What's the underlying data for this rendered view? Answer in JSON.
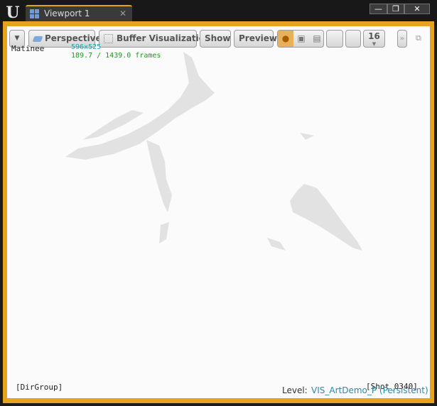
{
  "app": {
    "logo": "U"
  },
  "tab": {
    "title": "Viewport 1",
    "close": "✕",
    "icon": "viewport-grid-icon"
  },
  "window": {
    "minimize": "—",
    "maximize": "❐",
    "close": "✕"
  },
  "toolbar": {
    "menu": "▼",
    "perspective": "Perspective",
    "buffer": "Buffer Visualization",
    "show": "Show",
    "preview": "Preview",
    "view_modes": [
      "●",
      "▣",
      "▤"
    ],
    "number": "16",
    "next": "»",
    "restore": "⧉"
  },
  "overlay": {
    "matinee": "Matinee",
    "resolution": "596x525",
    "frames": "189.7 / 1439.0 frames",
    "group": "[DirGroup]",
    "level_label": "Level:",
    "level_name": "VIS_ArtDemo_P (Persistent)",
    "shot": "[Shot_0340]"
  },
  "colors": {
    "accent": "#e6a31d",
    "viewport_bg": "#fbfbfb",
    "resolution": "#1fa3b8",
    "frames": "#1a9a1a",
    "level_name": "#2a8aa6"
  }
}
